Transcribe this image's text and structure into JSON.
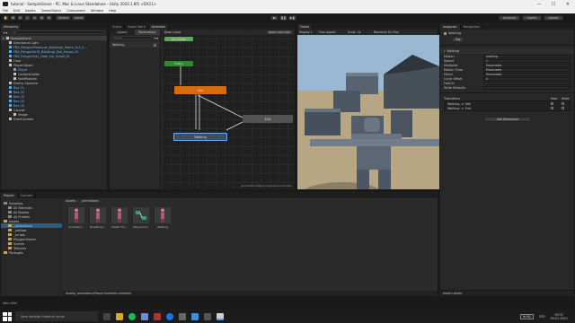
{
  "window": {
    "title": "tutorial - SampleScene - PC, Mac & Linux Standalone - Unity 2020.1.8f1 <DX11>",
    "controls": [
      "—",
      "☐",
      "✕"
    ]
  },
  "menu": [
    "File",
    "Edit",
    "Assets",
    "GameObject",
    "Component",
    "Window",
    "Help"
  ],
  "toolbar": {
    "tools": [
      "✋",
      "✥",
      "⟳",
      "⤢",
      "▭",
      "⊕",
      "⚙"
    ],
    "center_label": "Center",
    "local_label": "Local",
    "play": "▶",
    "pause": "❚❚",
    "step": "▶❚",
    "account_label": "Account",
    "layers_label": "Layers",
    "layout_label": "Layout"
  },
  "hierarchy": {
    "tab": "Hierarchy",
    "search_placeholder": "All",
    "items": [
      {
        "label": "SampleScene",
        "indent": 0,
        "type": "scene"
      },
      {
        "label": "Directional Light",
        "indent": 1,
        "type": "object"
      },
      {
        "label": "FBX_PolygonPrototype_Buildings_Stairs_1x1_0...",
        "indent": 1,
        "type": "prefab"
      },
      {
        "label": "FBX_PolygonSciFi_Buildings_Roll_House_01",
        "indent": 1,
        "type": "prefab"
      },
      {
        "label": "FBX_PolygonCity_Gate_Car_Small_01",
        "indent": 1,
        "type": "prefab"
      },
      {
        "label": "Floor",
        "indent": 1,
        "type": "object"
      },
      {
        "label": "PlayerObject",
        "indent": 1,
        "type": "object"
      },
      {
        "label": "Player",
        "indent": 2,
        "type": "prefab"
      },
      {
        "label": "CameraHolder",
        "indent": 2,
        "type": "object"
      },
      {
        "label": "HoldPosition",
        "indent": 2,
        "type": "object"
      },
      {
        "label": "Enemy Spawner",
        "indent": 1,
        "type": "object"
      },
      {
        "label": "Box (1)",
        "indent": 1,
        "type": "prefab"
      },
      {
        "label": "Box (2)",
        "indent": 1,
        "type": "prefab"
      },
      {
        "label": "Box (3)",
        "indent": 1,
        "type": "prefab"
      },
      {
        "label": "Box (4)",
        "indent": 1,
        "type": "prefab"
      },
      {
        "label": "Box (5)",
        "indent": 1,
        "type": "prefab"
      },
      {
        "label": "Canvas",
        "indent": 1,
        "type": "object"
      },
      {
        "label": "Image",
        "indent": 2,
        "type": "object"
      },
      {
        "label": "EventSystem",
        "indent": 1,
        "type": "object"
      }
    ]
  },
  "center_tabs": [
    "Scene",
    "Asset Store",
    "Animator"
  ],
  "animator": {
    "layers_tab": "Layers",
    "parameters_tab": "Parameters",
    "base_layer": "Base Layer",
    "auto_live_link": "Auto Live Link",
    "param_search_placeholder": "Name",
    "parameter": "Walking",
    "nodes": {
      "any_state": "Any State",
      "entry": "Entry",
      "idle": "Idle",
      "walking": "Walking",
      "exit": "Exit"
    },
    "footer_path": "_animations/PlayerController.controller"
  },
  "game": {
    "tab": "Game",
    "display": "Display 1",
    "aspect": "Free Aspect",
    "scale_label": "Scale",
    "scale_value": "1x",
    "maximize": "Maximize On Play"
  },
  "inspector": {
    "tabs": [
      "Inspector",
      "Navigation"
    ],
    "state_name": "Walking",
    "tag": "Tag",
    "header": "Walking",
    "fields": [
      {
        "label": "Motion",
        "value": "walking"
      },
      {
        "label": "Speed",
        "value": "1"
      },
      {
        "label": "Multiplier",
        "value": "Parameter"
      },
      {
        "label": "Motion Time",
        "value": "Parameter"
      },
      {
        "label": "Mirror",
        "value": "Parameter"
      },
      {
        "label": "Cycle Offset",
        "value": "0"
      },
      {
        "label": "Foot IK",
        "value": ""
      },
      {
        "label": "Write Defaults",
        "value": ""
      }
    ],
    "transitions_label": "Transitions",
    "solo_label": "Solo",
    "mute_label": "Mute",
    "transitions": [
      "Walking -> Idle",
      "Walking -> Exit"
    ],
    "add_behaviour": "Add Behaviour",
    "asset_labels": "Asset Labels"
  },
  "project": {
    "tabs": [
      "Project",
      "Console"
    ],
    "breadcrumb": [
      "Assets",
      "_animations"
    ],
    "tree": [
      {
        "label": "Favorites",
        "indent": 0,
        "folder": false
      },
      {
        "label": "All Materials",
        "indent": 1,
        "folder": false
      },
      {
        "label": "All Models",
        "indent": 1,
        "folder": false
      },
      {
        "label": "All Prefabs",
        "indent": 1,
        "folder": false
      },
      {
        "label": "Assets",
        "indent": 0,
        "folder": true
      },
      {
        "label": "_animations",
        "indent": 1,
        "folder": true
      },
      {
        "label": "_prefabs",
        "indent": 1,
        "folder": true
      },
      {
        "label": "_scripts",
        "indent": 1,
        "folder": true
      },
      {
        "label": "PolygonStarter",
        "indent": 1,
        "folder": true
      },
      {
        "label": "Scenes",
        "indent": 1,
        "folder": true
      },
      {
        "label": "Textures",
        "indent": 1,
        "folder": true
      },
      {
        "label": "Packages",
        "indent": 0,
        "folder": true
      }
    ],
    "assets": [
      "Animated ...",
      "Breathing...",
      "Death Fro...",
      "PlayerCont...",
      "Walking"
    ],
    "status_path": "Assets/_animations/PlayerController.controller"
  },
  "taskbar": {
    "search_placeholder": "Sem zadejte hledaný výraz",
    "tray_label": "NABIJ",
    "lang": "CES",
    "time": "09:37",
    "date": "09.01.2021"
  },
  "status_bar": "Idle (Idle)",
  "colors": {
    "idle_node": "#d86b0a",
    "entry_node": "#2e8b2e",
    "any_state_node": "#5aa85a",
    "exit_node": "#525252",
    "walking_node": "#3f4f63",
    "selection_blue": "#2c5d87",
    "sky": "#9bb8d3",
    "floor": "#b6a684"
  }
}
